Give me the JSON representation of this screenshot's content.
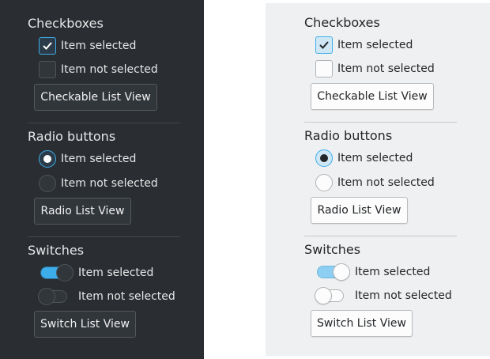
{
  "dark": {
    "checkboxes": {
      "heading": "Checkboxes",
      "item_selected": "Item selected",
      "item_not_selected": "Item not selected",
      "button": "Checkable List View"
    },
    "radio": {
      "heading": "Radio buttons",
      "item_selected": "Item selected",
      "item_not_selected": "Item not selected",
      "button": "Radio List View"
    },
    "switches": {
      "heading": "Switches",
      "item_selected": "Item selected",
      "item_not_selected": "Item not selected",
      "button": "Switch List View"
    }
  },
  "light": {
    "checkboxes": {
      "heading": "Checkboxes",
      "item_selected": "Item selected",
      "item_not_selected": "Item not selected",
      "button": "Checkable List View"
    },
    "radio": {
      "heading": "Radio buttons",
      "item_selected": "Item selected",
      "item_not_selected": "Item not selected",
      "button": "Radio List View"
    },
    "switches": {
      "heading": "Switches",
      "item_selected": "Item selected",
      "item_not_selected": "Item not selected",
      "button": "Switch List View"
    }
  },
  "colors": {
    "accent": "#3daee9",
    "dark_background": "#2a2e32",
    "light_background": "#eff0f1"
  }
}
